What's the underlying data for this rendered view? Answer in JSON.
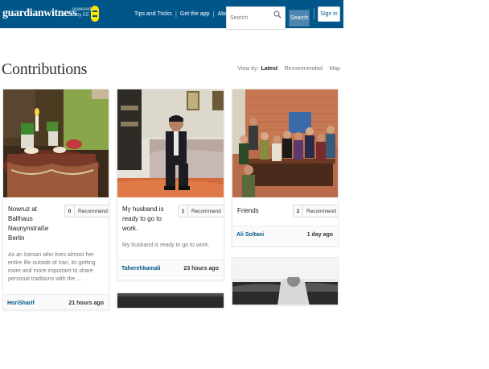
{
  "header": {
    "brand": "guardianwitness",
    "powered_by_line1": "powered",
    "powered_by_line2": "by EE",
    "nav": [
      "Tips and Tricks",
      "Get the app",
      "About"
    ],
    "search_placeholder": "Search",
    "search_button": "Search",
    "signin": "Sign in",
    "colors": {
      "bar": "#005689",
      "ee": "#ffe500"
    }
  },
  "main": {
    "title": "Contributions",
    "view_by_label": "View by",
    "view_options": [
      "Latest",
      "Recommended",
      "Map"
    ],
    "active_view": "Latest"
  },
  "cards": [
    {
      "title": "Nowruz at Ballhaus Naunynstraße Berlin",
      "recommend_count": "0",
      "recommend_label": "Recommend",
      "description": "As an Iranian who lives almost her entire life outside of Iran, its getting more and more important to share personal traditions with the ...",
      "author": "HoriSharif",
      "time": "21 hours ago"
    },
    {
      "title": "My husband is ready to go to work.",
      "recommend_count": "1",
      "recommend_label": "Recommend",
      "description": "My husband is ready to go to work.",
      "author": "Taherehkamali",
      "time": "23 hours ago"
    },
    {
      "title": "Friends",
      "recommend_count": "2",
      "recommend_label": "Recommend",
      "description": "",
      "author": "Ali Soltani",
      "time": "1 day ago"
    }
  ]
}
